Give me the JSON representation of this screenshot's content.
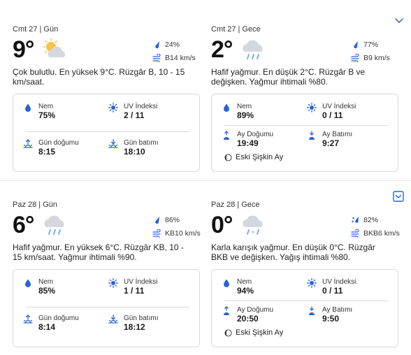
{
  "colors": {
    "accent": "#2764d6",
    "text": "#1a1a1a",
    "border": "#d9d9d9",
    "sun": "#f6c54a",
    "cloud": "#d4d8de"
  },
  "days": [
    {
      "period": "Cmt 27 | Gün",
      "temp": "9°",
      "icon": "partly-cloudy-sun-icon",
      "precip": "24%",
      "wind": "B14 km/s",
      "description": "Çok bulutlu. En yüksek 9°C. Rüzgâr B, 10 - 15 km/saat.",
      "details": {
        "humidity_label": "Nem",
        "humidity": "75%",
        "uv_label": "UV İndeksi",
        "uv": "2 / 11",
        "rise_label": "Gün doğumu",
        "rise": "8:15",
        "set_label": "Gün batımı",
        "set": "18:10"
      }
    },
    {
      "period": "Cmt 27 | Gece",
      "temp": "2°",
      "icon": "rain-cloud-icon",
      "precip": "77%",
      "wind": "B9 km/s",
      "description": "Hafif yağmur. En düşük 2°C. Rüzgâr B ve değişken. Yağmur ihtimali %80.",
      "details": {
        "humidity_label": "Nem",
        "humidity": "89%",
        "uv_label": "UV İndeksi",
        "uv": "0 / 11",
        "rise_label": "Ay Doğumu",
        "rise": "19:49",
        "set_label": "Ay Batımı",
        "set": "9:27",
        "moon_phase": "Eski Şişkin Ay"
      }
    },
    {
      "period": "Paz 28 | Gün",
      "temp": "6°",
      "icon": "rain-cloud-icon",
      "precip": "86%",
      "wind": "KB10 km/s",
      "description": "Hafif yağmur. En yüksek 6°C. Rüzgâr KB, 10 - 15 km/saat. Yağmur ihtimali %90.",
      "details": {
        "humidity_label": "Nem",
        "humidity": "85%",
        "uv_label": "UV İndeksi",
        "uv": "1 / 11",
        "rise_label": "Gün doğumu",
        "rise": "8:14",
        "set_label": "Gün batımı",
        "set": "18:12"
      }
    },
    {
      "period": "Paz 28 | Gece",
      "temp": "0°",
      "icon": "sleet-cloud-icon",
      "precip": "82%",
      "wind": "BKB6 km/s",
      "description": "Karla karışık yağmur. En düşük 0°C. Rüzgâr BKB ve değişken. Yağış ihtimali %80.",
      "details": {
        "humidity_label": "Nem",
        "humidity": "94%",
        "uv_label": "UV İndeksi",
        "uv": "0 / 11",
        "rise_label": "Ay Doğumu",
        "rise": "20:50",
        "set_label": "Ay Batımı",
        "set": "9:50",
        "moon_phase": "Eski Şişkin Ay"
      }
    }
  ]
}
